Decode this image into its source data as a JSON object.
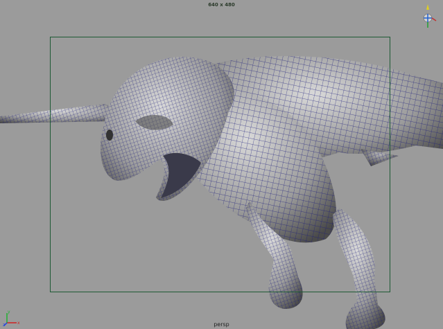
{
  "viewport": {
    "camera_name": "persp",
    "resolution_text": "640 x 480",
    "background_color": "#9b9b9b",
    "gate_color": "#1d5a34",
    "wireframe_color": "#1a1a7a",
    "model_icon": "t-rex-wireframe-mesh"
  },
  "gizmos": {
    "view_cube_icon": "view-cube-icon",
    "axis_icon": "xyz-axis-icon",
    "axis_labels": {
      "x": "x",
      "y": "y",
      "z": "z"
    }
  }
}
